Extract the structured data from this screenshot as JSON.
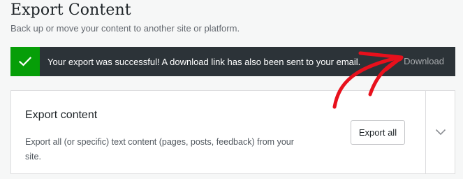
{
  "page": {
    "title": "Export Content",
    "subtitle": "Back up or move your content to another site or platform."
  },
  "notice": {
    "message": "Your export was successful! A download link has also been sent to your email.",
    "action_label": "Download",
    "icon": "checkmark-icon",
    "accent_color": "#069e08",
    "background_color": "#2c3338"
  },
  "export_card": {
    "title": "Export content",
    "description": "Export all (or specific) text content (pages, posts, feedback) from your site.",
    "button_label": "Export all",
    "toggle_icon": "chevron-down-icon"
  },
  "annotation": {
    "type": "arrow",
    "color": "#e8101c",
    "points_to": "Download"
  }
}
